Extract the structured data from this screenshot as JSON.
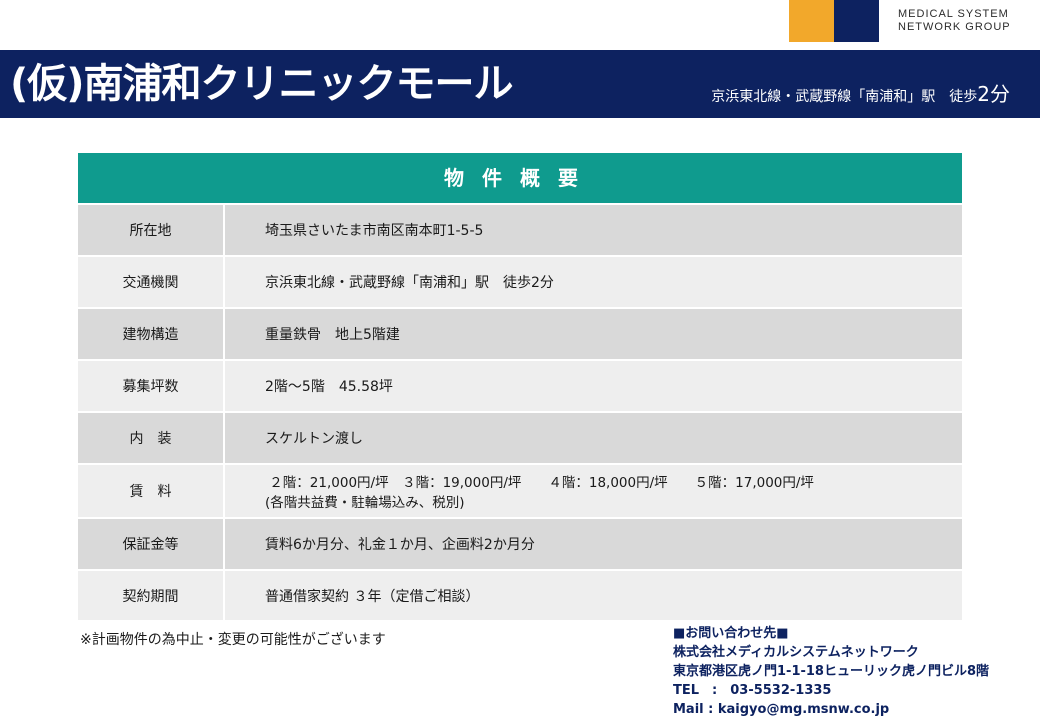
{
  "brand": {
    "line1": "MEDICAL SYSTEM",
    "line2": "NETWORK GROUP",
    "colors": {
      "orange": "#f2a82b",
      "navy": "#0d2260",
      "teal": "#0f9b8e"
    }
  },
  "header": {
    "title": "(仮)南浦和クリニックモール",
    "access_prefix": "京浜東北線・武蔵野線「南浦和」駅　徒歩",
    "access_minutes": "2分"
  },
  "table": {
    "heading": "物件概要",
    "rows": [
      {
        "label": "所在地",
        "value": "埼玉県さいたま市南区南本町1-5-5",
        "value2": ""
      },
      {
        "label": "交通機関",
        "value": "京浜東北線・武蔵野線「南浦和」駅　徒歩2分",
        "value2": ""
      },
      {
        "label": "建物構造",
        "value": "重量鉄骨　地上5階建",
        "value2": ""
      },
      {
        "label": "募集坪数",
        "value": "2階～5階　45.58坪",
        "value2": ""
      },
      {
        "label": "内　装",
        "value": "スケルトン渡し",
        "value2": ""
      },
      {
        "label": "賃　料",
        "value": " ２階：21,000円/坪　３階：19,000円/坪　　４階：18,000円/坪　　５階：17,000円/坪",
        "value2": "(各階共益費・駐輪場込み、税別)"
      },
      {
        "label": "保証金等",
        "value": "賃料6か月分、礼金１か月、企画料2か月分",
        "value2": ""
      },
      {
        "label": "契約期間",
        "value": "普通借家契約 ３年（定借ご相談）",
        "value2": ""
      }
    ]
  },
  "footer": {
    "note": "※計画物件の為中止・変更の可能性がございます",
    "contact": {
      "heading": "■お問い合わせ先■",
      "company": "株式会社メディカルシステムネットワーク",
      "address": "東京都港区虎ノ門1-1-18ヒューリック虎ノ門ビル8階",
      "tel": "TEL　:　03-5532-1335",
      "mail": "Mail : kaigyo@mg.msnw.co.jp"
    }
  }
}
